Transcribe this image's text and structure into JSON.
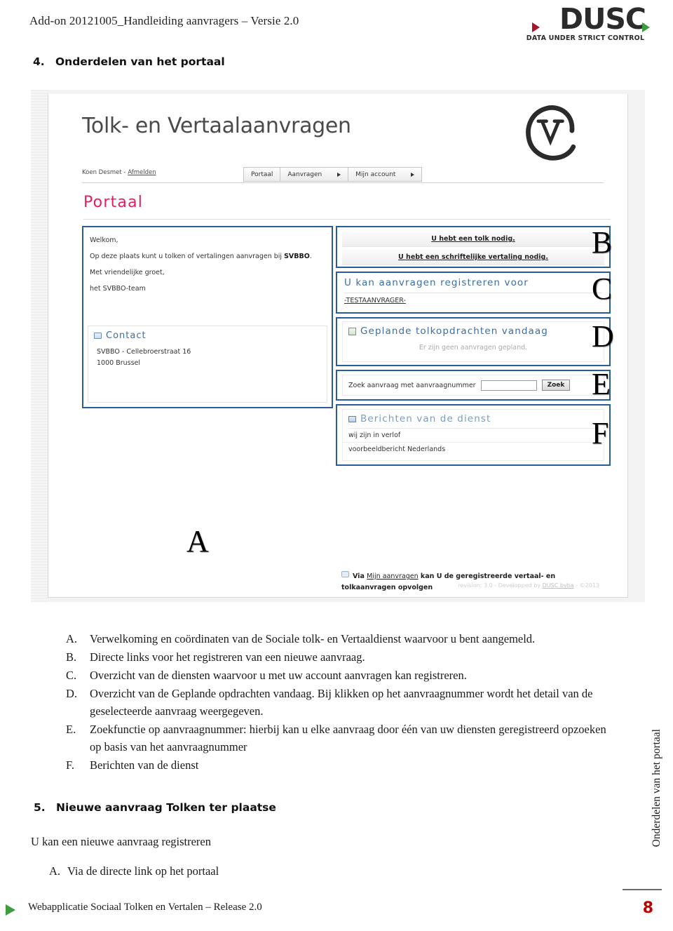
{
  "header": {
    "doc_title": "Add-on 20121005_Handleiding aanvragers – Versie 2.0",
    "logo_word": "DUSC",
    "logo_tagline": "DATA UNDER STRICT CONTROL"
  },
  "section4": {
    "number": "4.",
    "title": "Onderdelen van het portaal"
  },
  "screenshot": {
    "portal_title": "Tolk- en Vertaalaanvragen",
    "user": {
      "name": "Koen Desmet - ",
      "logout": "Afmelden"
    },
    "nav": [
      {
        "label": "Portaal",
        "caret": false
      },
      {
        "label": "Aanvragen",
        "caret": true
      },
      {
        "label": "Mijn account",
        "caret": true
      }
    ],
    "page_heading": "Portaal",
    "panel_a": {
      "welcome": "Welkom,",
      "line1_pre": "Op deze plaats kunt u tolken of vertalingen aanvragen bij ",
      "line1_bold": "SVBBO",
      "line1_post": ".",
      "greeting": "Met vriendelijke groet,",
      "team": "het SVBBO-team",
      "contact_title": "Contact",
      "contact_line1": "SVBBO - Cellebroerstraat 16",
      "contact_line2": "1000 Brussel"
    },
    "panel_b": {
      "link1": "U hebt een tolk nodig.",
      "link2": "U hebt een schriftelijke vertaling nodig."
    },
    "panel_c": {
      "title": "U kan aanvragen registreren voor",
      "item": "-TESTAANVRAGER-"
    },
    "panel_d": {
      "title": "Geplande tolkopdrachten vandaag",
      "empty": "Er zijn geen aanvragen gepland."
    },
    "panel_e": {
      "label": "Zoek aanvraag met aanvraagnummer",
      "input_value": "",
      "input_placeholder": "",
      "button": "Zoek"
    },
    "panel_f": {
      "title": "Berichten van de dienst",
      "msg1": "wij zijn in verlof",
      "msg2": "voorbeeldbericht Nederlands"
    },
    "note": {
      "pre": "Via ",
      "link": "Mijn aanvragen",
      "post": " kan U de geregistreerde vertaal- en tolkaanvragen opvolgen"
    },
    "revision": {
      "pre": "revision: 3.0 - Developped by ",
      "link": "DUSC bvba",
      "post": " - ©2013"
    },
    "markers": {
      "a": "A",
      "b": "B",
      "c": "C",
      "d": "D",
      "e": "E",
      "f": "F"
    }
  },
  "legend": [
    {
      "letter": "A.",
      "text": "Verwelkoming en coördinaten van de Sociale tolk- en Vertaaldienst waarvoor u bent aangemeld."
    },
    {
      "letter": "B.",
      "text": "Directe links voor het registreren van een nieuwe aanvraag."
    },
    {
      "letter": "C.",
      "text": "Overzicht van de diensten waarvoor u met uw account aanvragen kan registreren."
    },
    {
      "letter": "D.",
      "text": "Overzicht van de Geplande opdrachten vandaag. Bij klikken op het aanvraagnummer wordt het detail van de geselecteerde aanvraag weergegeven."
    },
    {
      "letter": "E.",
      "text": "Zoekfunctie op aanvraagnummer: hierbij kan u elke aanvraag door één van uw diensten geregistreerd opzoeken op basis van het aanvraagnummer"
    },
    {
      "letter": "F.",
      "text": "Berichten van de dienst"
    }
  ],
  "section5": {
    "number": "5.",
    "title": "Nieuwe aanvraag Tolken ter plaatse",
    "intro": "U kan een nieuwe aanvraag registreren",
    "sub_letter": "A.",
    "sub_text": "Via de directe link op het portaal"
  },
  "footer": {
    "text": "Webapplicatie Sociaal Tolken en Vertalen – Release 2.0",
    "side_label": "Onderdelen van het portaal",
    "page_number": "8"
  },
  "colors": {
    "pink_heading": "#e51e63",
    "panel_border": "#2a5c96",
    "section_title_blue": "#3b6ea5",
    "page_number_red": "#c00000",
    "accent_green": "#3d9c3d",
    "accent_red": "#a8152a"
  }
}
